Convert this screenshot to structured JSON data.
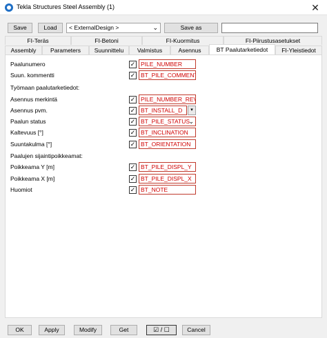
{
  "window": {
    "title": "Tekla Structures  Steel Assembly (1)",
    "close_glyph": "✕"
  },
  "toolbar": {
    "save_label": "Save",
    "load_label": "Load",
    "attribute_file": "< ExternalDesign >",
    "save_as_label": "Save as",
    "save_as_value": ""
  },
  "tabs_row1": [
    "FI-Teräs",
    "FI-Betoni",
    "FI-Kuormitus",
    "FI-Piirustusasetukset"
  ],
  "tabs_row2": [
    "Assembly",
    "Parameters",
    "Suunnittelu",
    "Valmistus",
    "Asennus",
    "BT Paalutarketiedot",
    "FI-Yleistiedot"
  ],
  "active_tab": "BT Paalutarketiedot",
  "form": {
    "rows": [
      {
        "label": "Paalunumero",
        "checked": true,
        "value": "PILE_NUMBER"
      },
      {
        "label": "Suun. kommentti",
        "checked": true,
        "value": "BT_PILE_COMMENT"
      },
      {
        "label": "Työmaan paalutarketiedot:"
      },
      {
        "label": "Asennus merkintä",
        "checked": true,
        "value": "PILE_NUMBER_REV"
      },
      {
        "label": "Asennus pvm.",
        "checked": true,
        "value": "BT_INSTALL_D"
      },
      {
        "label": "Paalun status",
        "checked": true,
        "value": "BT_PILE_STATUS"
      },
      {
        "label": "Kaltevuus [°]",
        "checked": true,
        "value": "BT_INCLINATION"
      },
      {
        "label": "Suuntakulma [°]",
        "checked": true,
        "value": "BT_ORIENTATION"
      },
      {
        "label": "Paalujen sijaintipoikkeamat:"
      },
      {
        "label": "Poikkeama Y [m]",
        "checked": true,
        "value": "BT_PILE_DISPL_Y"
      },
      {
        "label": "Poikkeama X [m]",
        "checked": true,
        "value": "BT_PILE_DISPL_X"
      },
      {
        "label": "Huomiot",
        "checked": true,
        "value": "BT_NOTE"
      }
    ]
  },
  "glyphs": {
    "check": "✓",
    "dropdown": "⌄",
    "spin": "▾"
  },
  "footer": {
    "ok_label": "OK",
    "apply_label": "Apply",
    "modify_label": "Modify",
    "get_label": "Get",
    "toggle_label": "☑ / ☐",
    "cancel_label": "Cancel"
  }
}
